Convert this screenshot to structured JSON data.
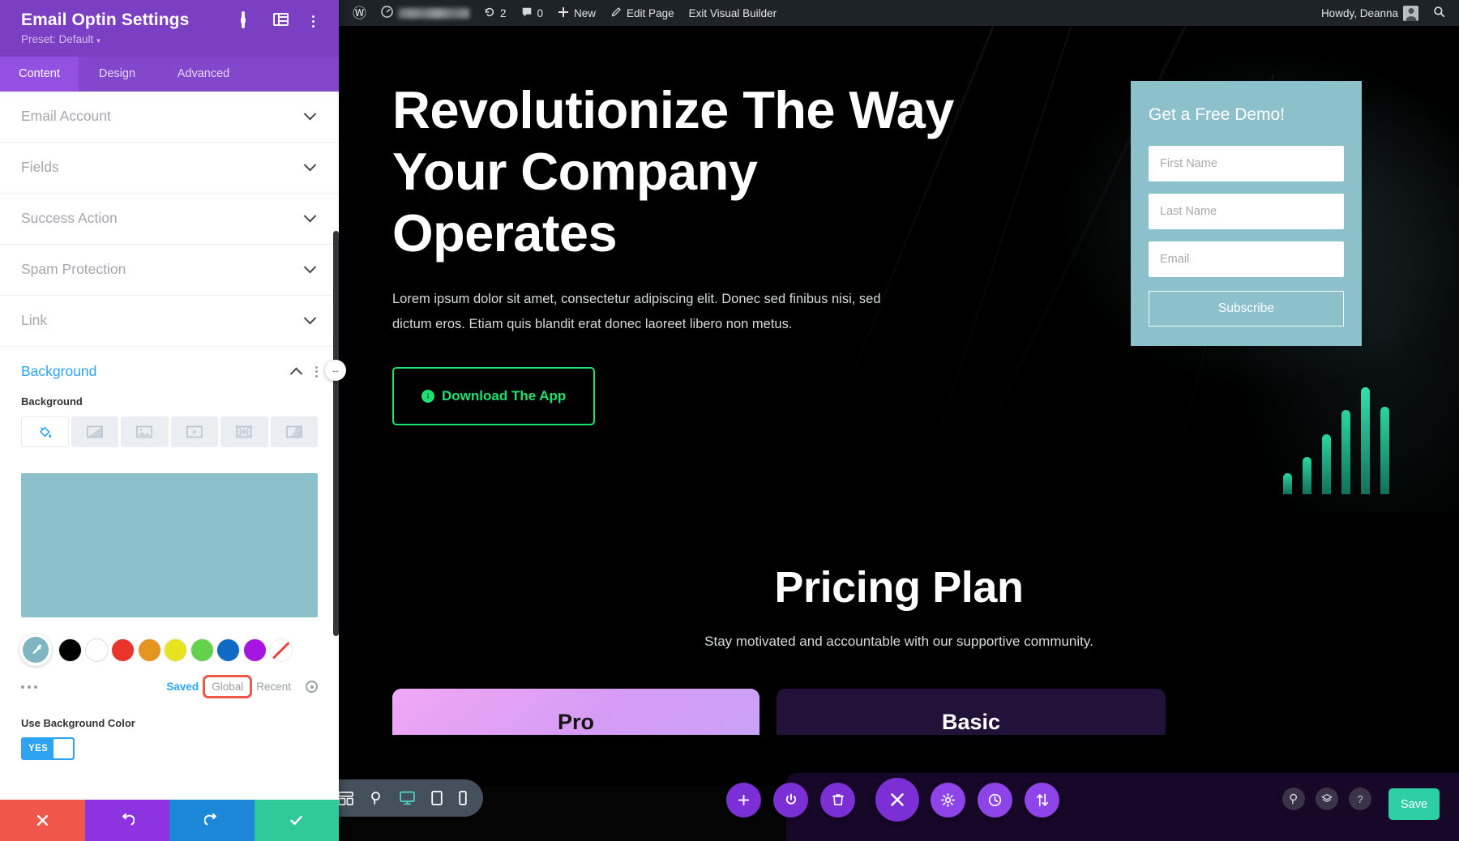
{
  "sidebar": {
    "title": "Email Optin Settings",
    "preset": "Preset: Default",
    "preset_caret": "▾",
    "header_icons": [
      {
        "name": "focus-icon"
      },
      {
        "name": "layout-panel-icon"
      },
      {
        "name": "kebab-menu-icon"
      }
    ],
    "tabs": [
      {
        "label": "Content",
        "active": true
      },
      {
        "label": "Design",
        "active": false
      },
      {
        "label": "Advanced",
        "active": false
      }
    ],
    "sections": [
      {
        "label": "Email Account",
        "open": false
      },
      {
        "label": "Fields",
        "open": false
      },
      {
        "label": "Success Action",
        "open": false
      },
      {
        "label": "Spam Protection",
        "open": false
      },
      {
        "label": "Link",
        "open": false
      },
      {
        "label": "Background",
        "open": true
      }
    ],
    "background": {
      "field_label": "Background",
      "types": [
        {
          "name": "background-color-icon",
          "active": true
        },
        {
          "name": "background-gradient-icon",
          "active": false
        },
        {
          "name": "background-image-icon",
          "active": false
        },
        {
          "name": "background-video-icon",
          "active": false
        },
        {
          "name": "background-pattern-icon",
          "active": false
        },
        {
          "name": "background-mask-icon",
          "active": false
        }
      ],
      "preview_color": "#8cc1cc",
      "selected_swatch_color": "#7fb5c0",
      "swatches": [
        {
          "name": "swatch-black",
          "color": "#000000"
        },
        {
          "name": "swatch-white",
          "color": "#ffffff"
        },
        {
          "name": "swatch-red",
          "color": "#e8342a"
        },
        {
          "name": "swatch-orange",
          "color": "#e39520"
        },
        {
          "name": "swatch-yellow",
          "color": "#e8e321"
        },
        {
          "name": "swatch-green",
          "color": "#63d24a"
        },
        {
          "name": "swatch-blue",
          "color": "#1069c4"
        },
        {
          "name": "swatch-purple",
          "color": "#a715e0"
        },
        {
          "name": "swatch-transparent",
          "color": "transparent"
        }
      ],
      "preset_tabs": [
        {
          "label": "Saved",
          "state": "active"
        },
        {
          "label": "Global",
          "state": "highlighted"
        },
        {
          "label": "Recent",
          "state": "normal"
        }
      ],
      "use_bg_color_label": "Use Background Color",
      "toggle_value": "YES"
    },
    "footer_buttons": [
      {
        "name": "cancel-button",
        "icon": "close-icon",
        "color": "#f0564a"
      },
      {
        "name": "undo-button",
        "icon": "undo-icon",
        "color": "#8d33e0"
      },
      {
        "name": "redo-button",
        "icon": "redo-icon",
        "color": "#1e88d8"
      },
      {
        "name": "save-button",
        "icon": "check-icon",
        "color": "#30c99a"
      }
    ]
  },
  "wp_admin_bar": {
    "logo": "Ⓦ",
    "site_name": "",
    "revisions_count": "2",
    "comments_count": "0",
    "new_label": "New",
    "edit_page_label": "Edit Page",
    "exit_builder_label": "Exit Visual Builder",
    "howdy": "Howdy, Deanna"
  },
  "hero": {
    "heading": "Revolutionize The Way Your Company Operates",
    "paragraph": "Lorem ipsum dolor sit amet, consectetur adipiscing elit. Donec sed finibus nisi, sed dictum eros. Etiam quis blandit erat donec laoreet libero non metus.",
    "button_label": "Download The App",
    "button_icon": "download-circle-icon"
  },
  "optin_form": {
    "title": "Get a Free Demo!",
    "fields": [
      {
        "name": "first-name-input",
        "placeholder": "First Name",
        "value": ""
      },
      {
        "name": "last-name-input",
        "placeholder": "Last Name",
        "value": ""
      },
      {
        "name": "email-input",
        "placeholder": "Email",
        "value": ""
      }
    ],
    "submit_label": "Subscribe",
    "background_color": "#8cc1cc"
  },
  "pricing": {
    "heading": "Pricing Plan",
    "subheading": "Stay motivated and accountable with our supportive community.",
    "cards": [
      {
        "name": "Pro"
      },
      {
        "name": "Basic"
      }
    ]
  },
  "vb_toolbar": {
    "left_icons": [
      {
        "name": "kebab-menu-icon",
        "active": false
      },
      {
        "name": "wireframe-view-icon",
        "active": false
      },
      {
        "name": "zoom-out-view-icon",
        "active": false
      },
      {
        "name": "desktop-view-icon",
        "active": true
      },
      {
        "name": "tablet-view-icon",
        "active": false
      },
      {
        "name": "phone-view-icon",
        "active": false
      }
    ],
    "center_buttons": [
      {
        "name": "add-module-button",
        "icon": "plus-icon"
      },
      {
        "name": "toggle-builder-button",
        "icon": "power-icon"
      },
      {
        "name": "delete-button",
        "icon": "trash-icon"
      },
      {
        "name": "close-settings-button",
        "icon": "close-icon"
      },
      {
        "name": "settings-button",
        "icon": "gear-icon"
      },
      {
        "name": "history-button",
        "icon": "clock-icon"
      },
      {
        "name": "sort-button",
        "icon": "updown-arrows-icon"
      }
    ],
    "right_icons": [
      {
        "name": "search-icon"
      },
      {
        "name": "layers-icon"
      },
      {
        "name": "help-icon",
        "label": "?"
      }
    ],
    "save_label": "Save"
  }
}
